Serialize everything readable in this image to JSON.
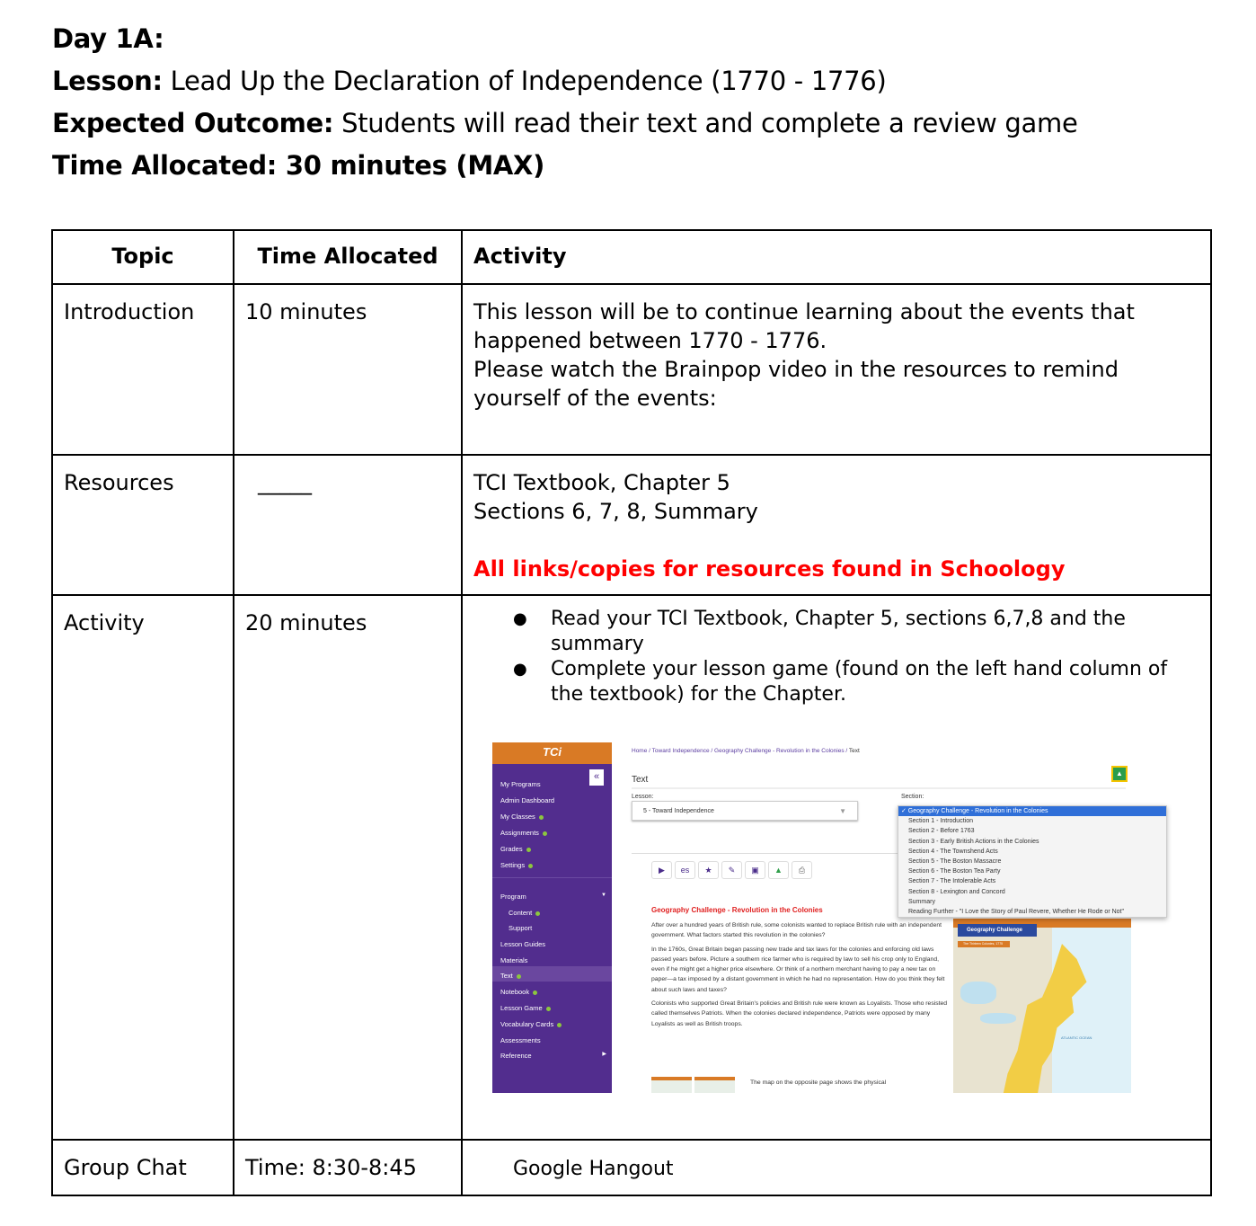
{
  "header": {
    "day": "Day 1A:",
    "lesson_label": "Lesson:",
    "lesson_value": " Lead Up the Declaration of Independence (1770 - 1776)",
    "outcome_label": "Expected Outcome:",
    "outcome_value": " Students will read their text and complete a review game",
    "time_line": "Time Allocated: 30 minutes (MAX)"
  },
  "table": {
    "headers": [
      "Topic",
      "Time Allocated",
      "Activity"
    ],
    "rows": [
      {
        "topic": "Introduction",
        "time": "10 minutes",
        "activity_lines": [
          "This lesson will be to continue learning about the events that happened between 1770 - 1776.",
          "Please watch the Brainpop video in the resources to remind yourself of the events:"
        ]
      },
      {
        "topic": "Resources",
        "time": "_____",
        "activity_lines": [
          "TCI Textbook, Chapter 5",
          "Sections 6, 7, 8, Summary"
        ],
        "note": "All links/copies for resources found in Schoology",
        "note_color": "#ff0000"
      },
      {
        "topic": "Activity",
        "time": "20 minutes",
        "bullets": [
          "Read your TCI Textbook, Chapter 5, sections 6,7,8 and the summary",
          "Complete your lesson game (found on the left hand column of the textbook) for the Chapter."
        ]
      },
      {
        "topic": "Group Chat",
        "time": "Time: 8:30-8:45",
        "activity": "Google Hangout"
      }
    ]
  },
  "tci": {
    "logo": "TCi",
    "collapse_icon": "double-chevron-left",
    "sidebar": [
      {
        "label": "My Programs",
        "dot": false
      },
      {
        "label": "Admin Dashboard",
        "dot": false
      },
      {
        "label": "My Classes",
        "dot": true
      },
      {
        "label": "Assignments",
        "dot": true
      },
      {
        "label": "Grades",
        "dot": true
      },
      {
        "label": "Settings",
        "dot": true
      },
      {
        "label": "Program",
        "dot": false
      },
      {
        "label": "Content",
        "dot": true
      },
      {
        "label": "Support",
        "dot": false
      },
      {
        "label": "Lesson Guides",
        "dot": false
      },
      {
        "label": "Materials",
        "dot": false
      },
      {
        "label": "Text",
        "dot": true
      },
      {
        "label": "Notebook",
        "dot": true
      },
      {
        "label": "Lesson Game",
        "dot": true
      },
      {
        "label": "Vocabulary Cards",
        "dot": true
      },
      {
        "label": "Assessments",
        "dot": false
      },
      {
        "label": "Reference",
        "dot": false
      }
    ],
    "breadcrumb": [
      "Home",
      "Toward Independence",
      "Geography Challenge - Revolution in the Colonies",
      "Text"
    ],
    "page_title": "Text",
    "lesson_label": "Lesson:",
    "lesson_value": "5 - Toward Independence",
    "section_label": "Section:",
    "section_options": [
      "✓ Geography Challenge - Revolution in the Colonies",
      "Section 1 - Introduction",
      "Section 2 - Before 1763",
      "Section 3 - Early British Actions in the Colonies",
      "Section 4 - The Townshend Acts",
      "Section 5 - The Boston Massacre",
      "Section 6 - The Boston Tea Party",
      "Section 7 - The Intolerable Acts",
      "Section 8 - Lexington and Concord",
      "Summary",
      "Reading Further - \"I Love the Story of Paul Revere, Whether He Rode or Not\""
    ],
    "toolbar": {
      "play": "▶",
      "spanish": "es",
      "star": "★",
      "highlight": "✎",
      "note": "▣",
      "drive": "▲",
      "print": "⎙"
    },
    "article_title": "Geography Challenge - Revolution in the Colonies",
    "paragraphs": [
      "After over a hundred years of British rule, some colonists wanted to replace British rule with an independent government. What factors started this revolution in the colonies?",
      "In the 1760s, Great Britain began passing new trade and tax laws for the colonies and enforcing old laws passed years before. Picture a southern rice farmer who is required by law to sell his crop only to England, even if he might get a higher price elsewhere. Or think of a northern merchant having to pay a new tax on paper—a tax imposed by a distant government in which he had no representation. How do you think they felt about such laws and taxes?",
      "Colonists who supported Great Britain's policies and British rule were known as Loyalists. Those who resisted called themselves Patriots. When the colonies declared independence, Patriots were opposed by many Loyalists as well as British troops."
    ],
    "thumb_caption": "The map on the opposite page shows the physical",
    "map_banner": "Geography Challenge",
    "map_subtitle": "The Thirteen Colonies, 1775",
    "map_ocean_label": "ATLANTIC OCEAN"
  }
}
